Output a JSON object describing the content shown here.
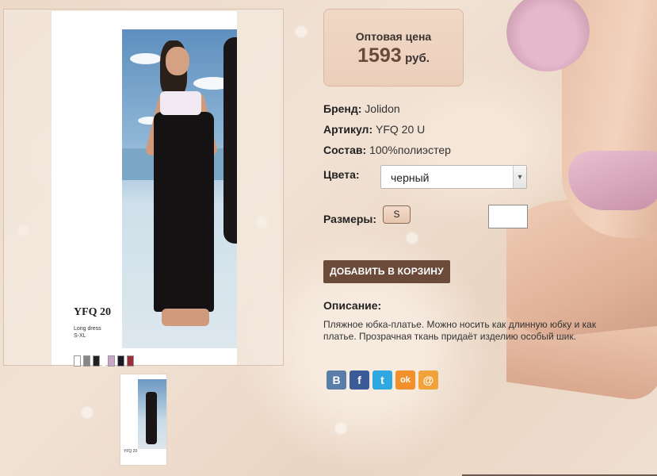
{
  "product": {
    "image": {
      "code": "YFQ 20",
      "caption_line1": "Long dress",
      "caption_line2": "S-XL"
    },
    "thumbnail": {
      "text_line1": "YFQ 20"
    }
  },
  "price": {
    "label": "Оптовая цена",
    "value": "1593",
    "currency": "руб."
  },
  "attributes": {
    "brand_label": "Бренд:",
    "brand_value": "Jolidon",
    "article_label": "Артикул:",
    "article_value": "YFQ 20 U",
    "composition_label": "Состав:",
    "composition_value": "100%полиэстер"
  },
  "colors": {
    "label": "Цвета:",
    "selected": "черный"
  },
  "sizes": {
    "label": "Размеры:",
    "options": [
      "S"
    ]
  },
  "cart": {
    "button_label": "ДОБАВИТЬ В КОРЗИНУ"
  },
  "description": {
    "title": "Описание:",
    "text": "Пляжное юбка-платье. Можно носить как длинную юбку и как платье. Прозрачная ткань придаёт изделию особый шик."
  },
  "share": {
    "vk": "B",
    "fb": "f",
    "tw": "t",
    "ok": "ok",
    "mail": "@"
  },
  "colors_palette": {
    "accent_button": "#6b4a3a",
    "price_value": "#6a4a3a",
    "price_box_bg": "#ebcfbb"
  }
}
